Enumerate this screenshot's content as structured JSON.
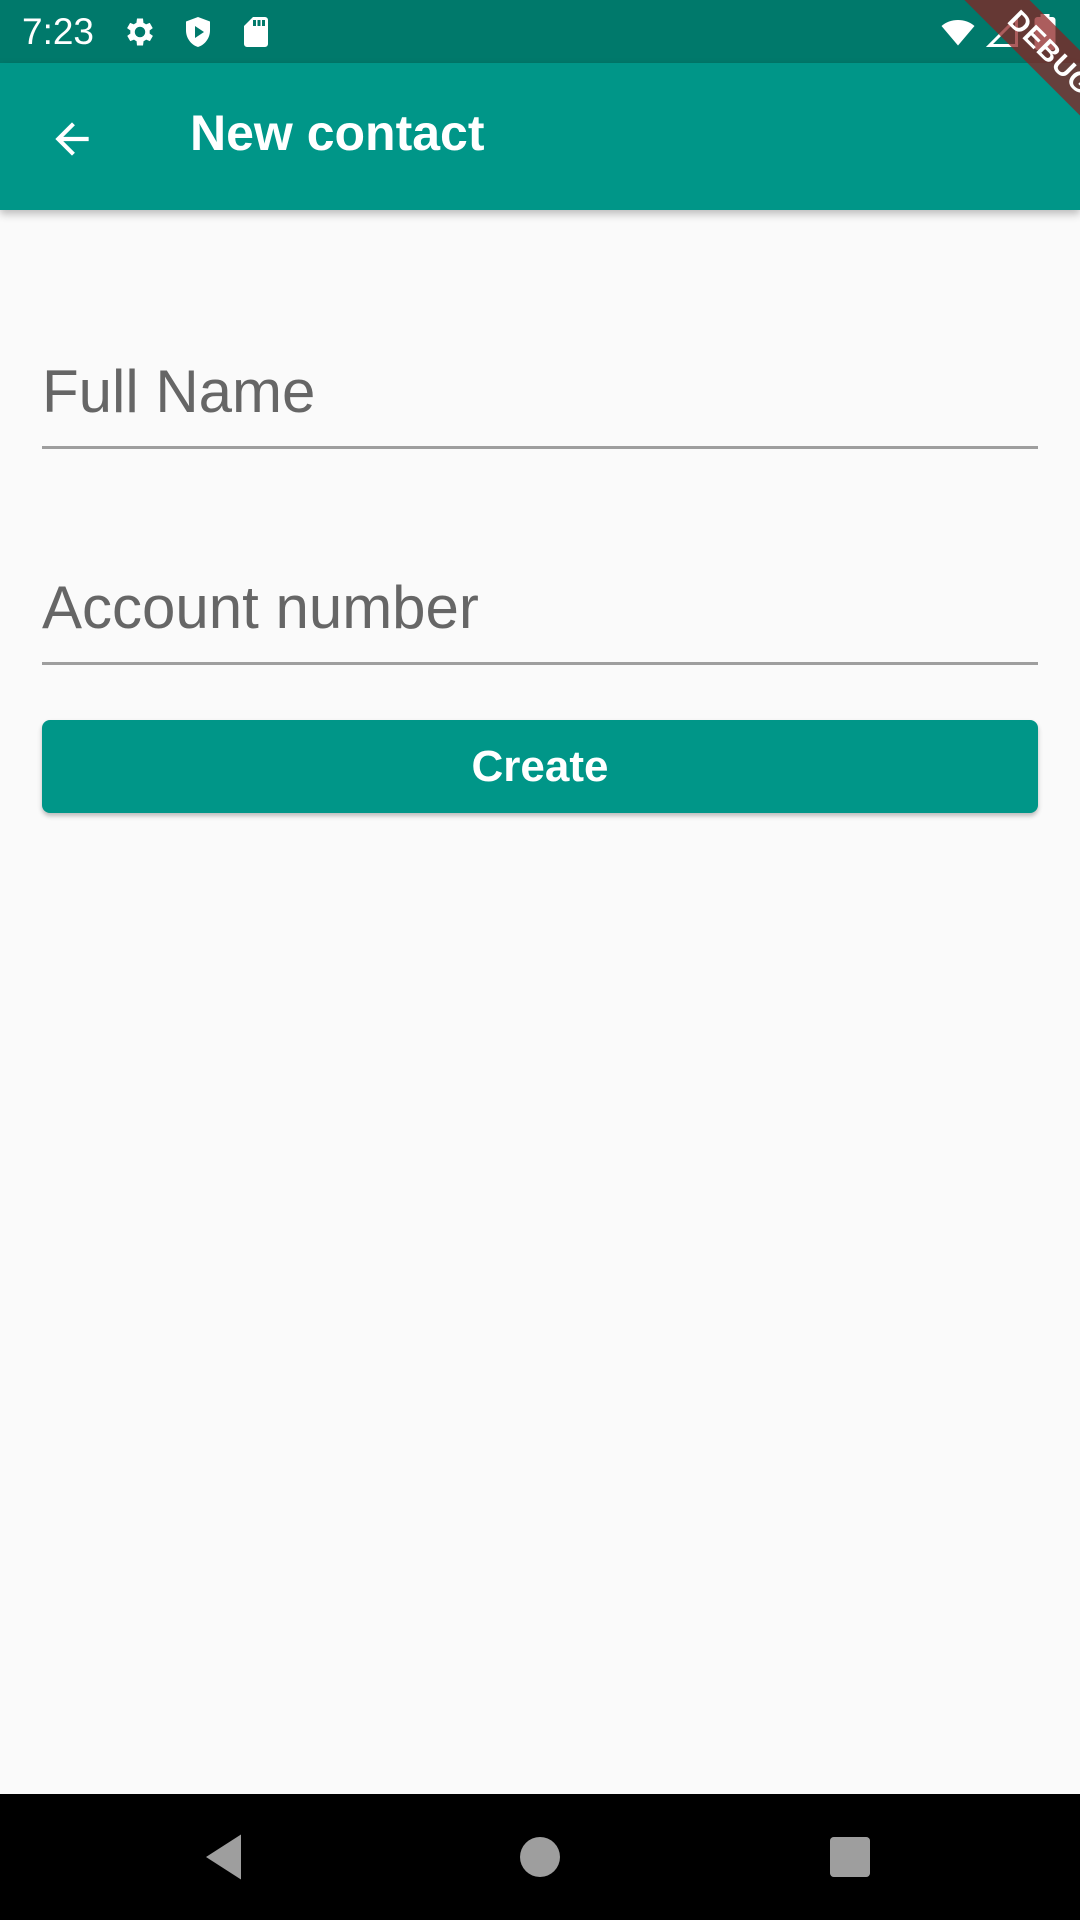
{
  "status_bar": {
    "time": "7:23",
    "icons": [
      "gear-icon",
      "play-shield-icon",
      "sd-card-icon",
      "wifi-icon",
      "signal-icon",
      "battery-icon"
    ]
  },
  "app_bar": {
    "title": "New contact",
    "back_icon": "arrow-back-icon",
    "background_color": "#009688"
  },
  "debug_banner": {
    "label": "DEBUG"
  },
  "form": {
    "full_name": {
      "placeholder": "Full Name",
      "value": ""
    },
    "account_number": {
      "placeholder": "Account number",
      "value": ""
    },
    "create_label": "Create"
  },
  "nav_bar": {
    "icons": [
      "back-triangle-icon",
      "home-circle-icon",
      "recents-square-icon"
    ]
  },
  "colors": {
    "primary": "#009688",
    "status_bar": "#00796b",
    "background": "#fafafa"
  }
}
